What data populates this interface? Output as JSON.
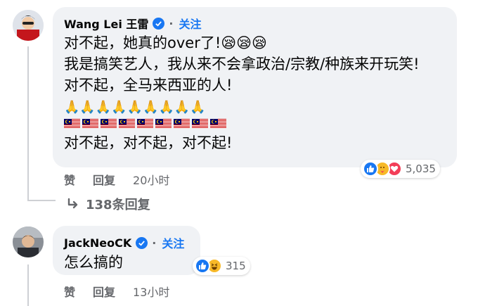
{
  "comments": [
    {
      "author": "Wang Lei 王雷",
      "follow_label": "关注",
      "lines": [
        "对不起，她真的over了!😪😪😪",
        "我是搞笑艺人，我从来不会拿政治/宗教/种族来开玩笑!",
        "对不起，全马来西亚的人!",
        "对不起，对不起，对不起!"
      ],
      "pray_emojis": "🙏🙏🙏🙏🙏🙏🙏🙏🙏",
      "flag_count": 9,
      "like_label": "赞",
      "reply_label": "回复",
      "time": "20小时",
      "reaction_count": "5,035",
      "view_replies": "138条回复"
    },
    {
      "author": "JackNeoCK",
      "follow_label": "关注",
      "lines": [
        "怎么搞的"
      ],
      "like_label": "赞",
      "reply_label": "回复",
      "time": "13小时",
      "reaction_count": "315"
    }
  ],
  "colors": {
    "bubble": "#f0f2f5",
    "accent": "#1877f2",
    "muted": "#65676b",
    "love": "#f33e58",
    "haha": "#f7b928"
  }
}
